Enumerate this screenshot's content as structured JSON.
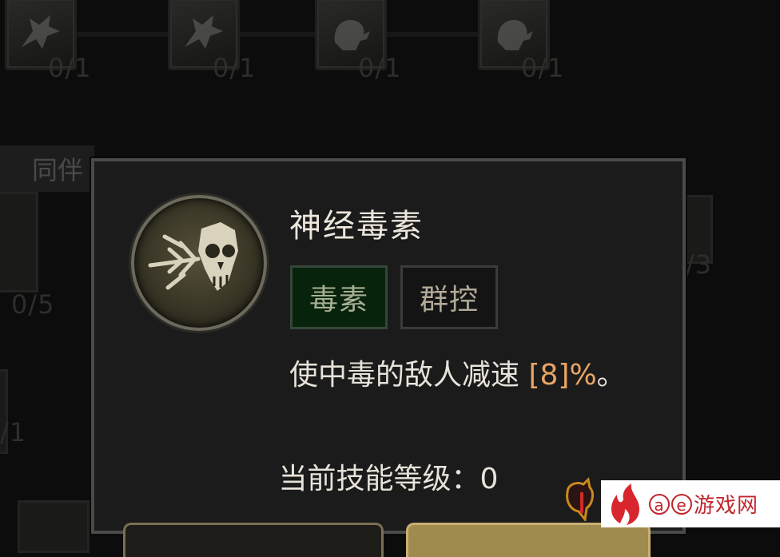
{
  "background": {
    "top_skills": [
      {
        "icon": "wolf-icon",
        "count": "0/1"
      },
      {
        "icon": "wolf-icon",
        "count": "0/1"
      },
      {
        "icon": "bear-roar-icon",
        "count": "0/1"
      },
      {
        "icon": "bear-roar-icon",
        "count": "0/1"
      }
    ],
    "companion_label": "同伴",
    "side_counts": [
      "0/5",
      "/1",
      "/3"
    ]
  },
  "tooltip": {
    "skill_name": "神经毒素",
    "skill_icon": "poison-skull-arrow-icon",
    "tags": [
      "毒素",
      "群控"
    ],
    "description_prefix": "使中毒的敌人减速 ",
    "description_value": "[8]%",
    "description_suffix": "。",
    "level_label": "当前技能等级：",
    "level_value": "0"
  },
  "watermark": {
    "brand": "游戏网",
    "letters": [
      "a",
      "e"
    ]
  },
  "colors": {
    "panel_bg": "#1b1b1b",
    "panel_border": "#4a4a48",
    "poison_tag_bg": "#08230c",
    "value_highlight": "#e8a565",
    "watermark_red": "#c0262d"
  }
}
